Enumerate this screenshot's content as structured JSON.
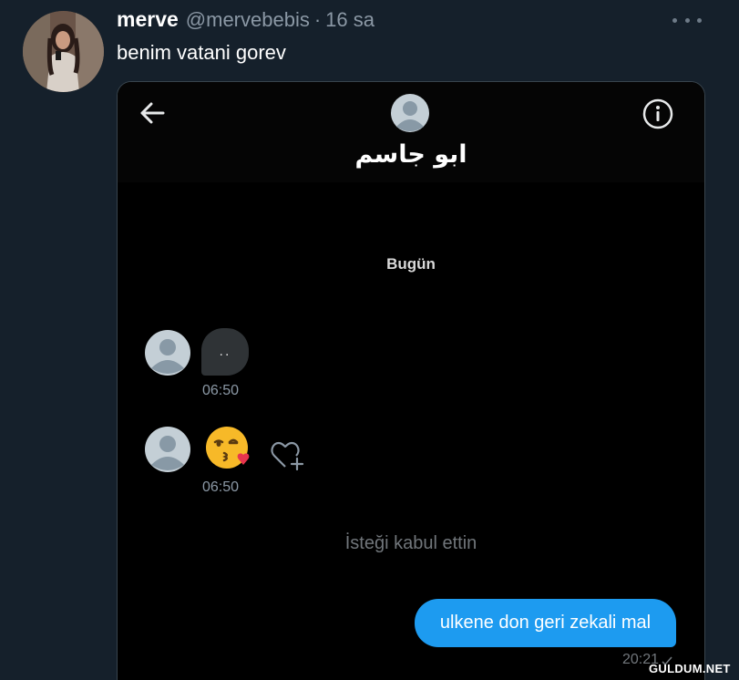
{
  "tweet": {
    "display_name": "merve",
    "handle": "@mervebebis",
    "separator": "·",
    "time": "16 sa",
    "text": "benim vatani gorev",
    "avatar_icon": "profile-photo",
    "more_icon": "more-dots-icon"
  },
  "dm_screenshot": {
    "header": {
      "back_icon": "arrow-left-icon",
      "info_icon": "info-icon",
      "contact_name": "ابو جاسم"
    },
    "date_label": "Bugün",
    "messages": [
      {
        "type": "text",
        "direction": "incoming",
        "text": "..",
        "time": "06:50"
      },
      {
        "type": "emoji",
        "direction": "incoming",
        "emoji": "face-blowing-a-kiss",
        "time": "06:50"
      }
    ],
    "system_message": "İsteği kabul ettin",
    "outgoing": {
      "text": "ulkene don geri zekali mal",
      "time": "20:21",
      "status_icon": "check-icon"
    },
    "colors": {
      "outgoing_bubble": "#1d9bf0",
      "incoming_bubble": "#2f3336",
      "background": "#000000"
    }
  },
  "watermark": "GULDUM.NET",
  "colors": {
    "page_background": "#15202b",
    "secondary_text": "#8b98a5"
  }
}
